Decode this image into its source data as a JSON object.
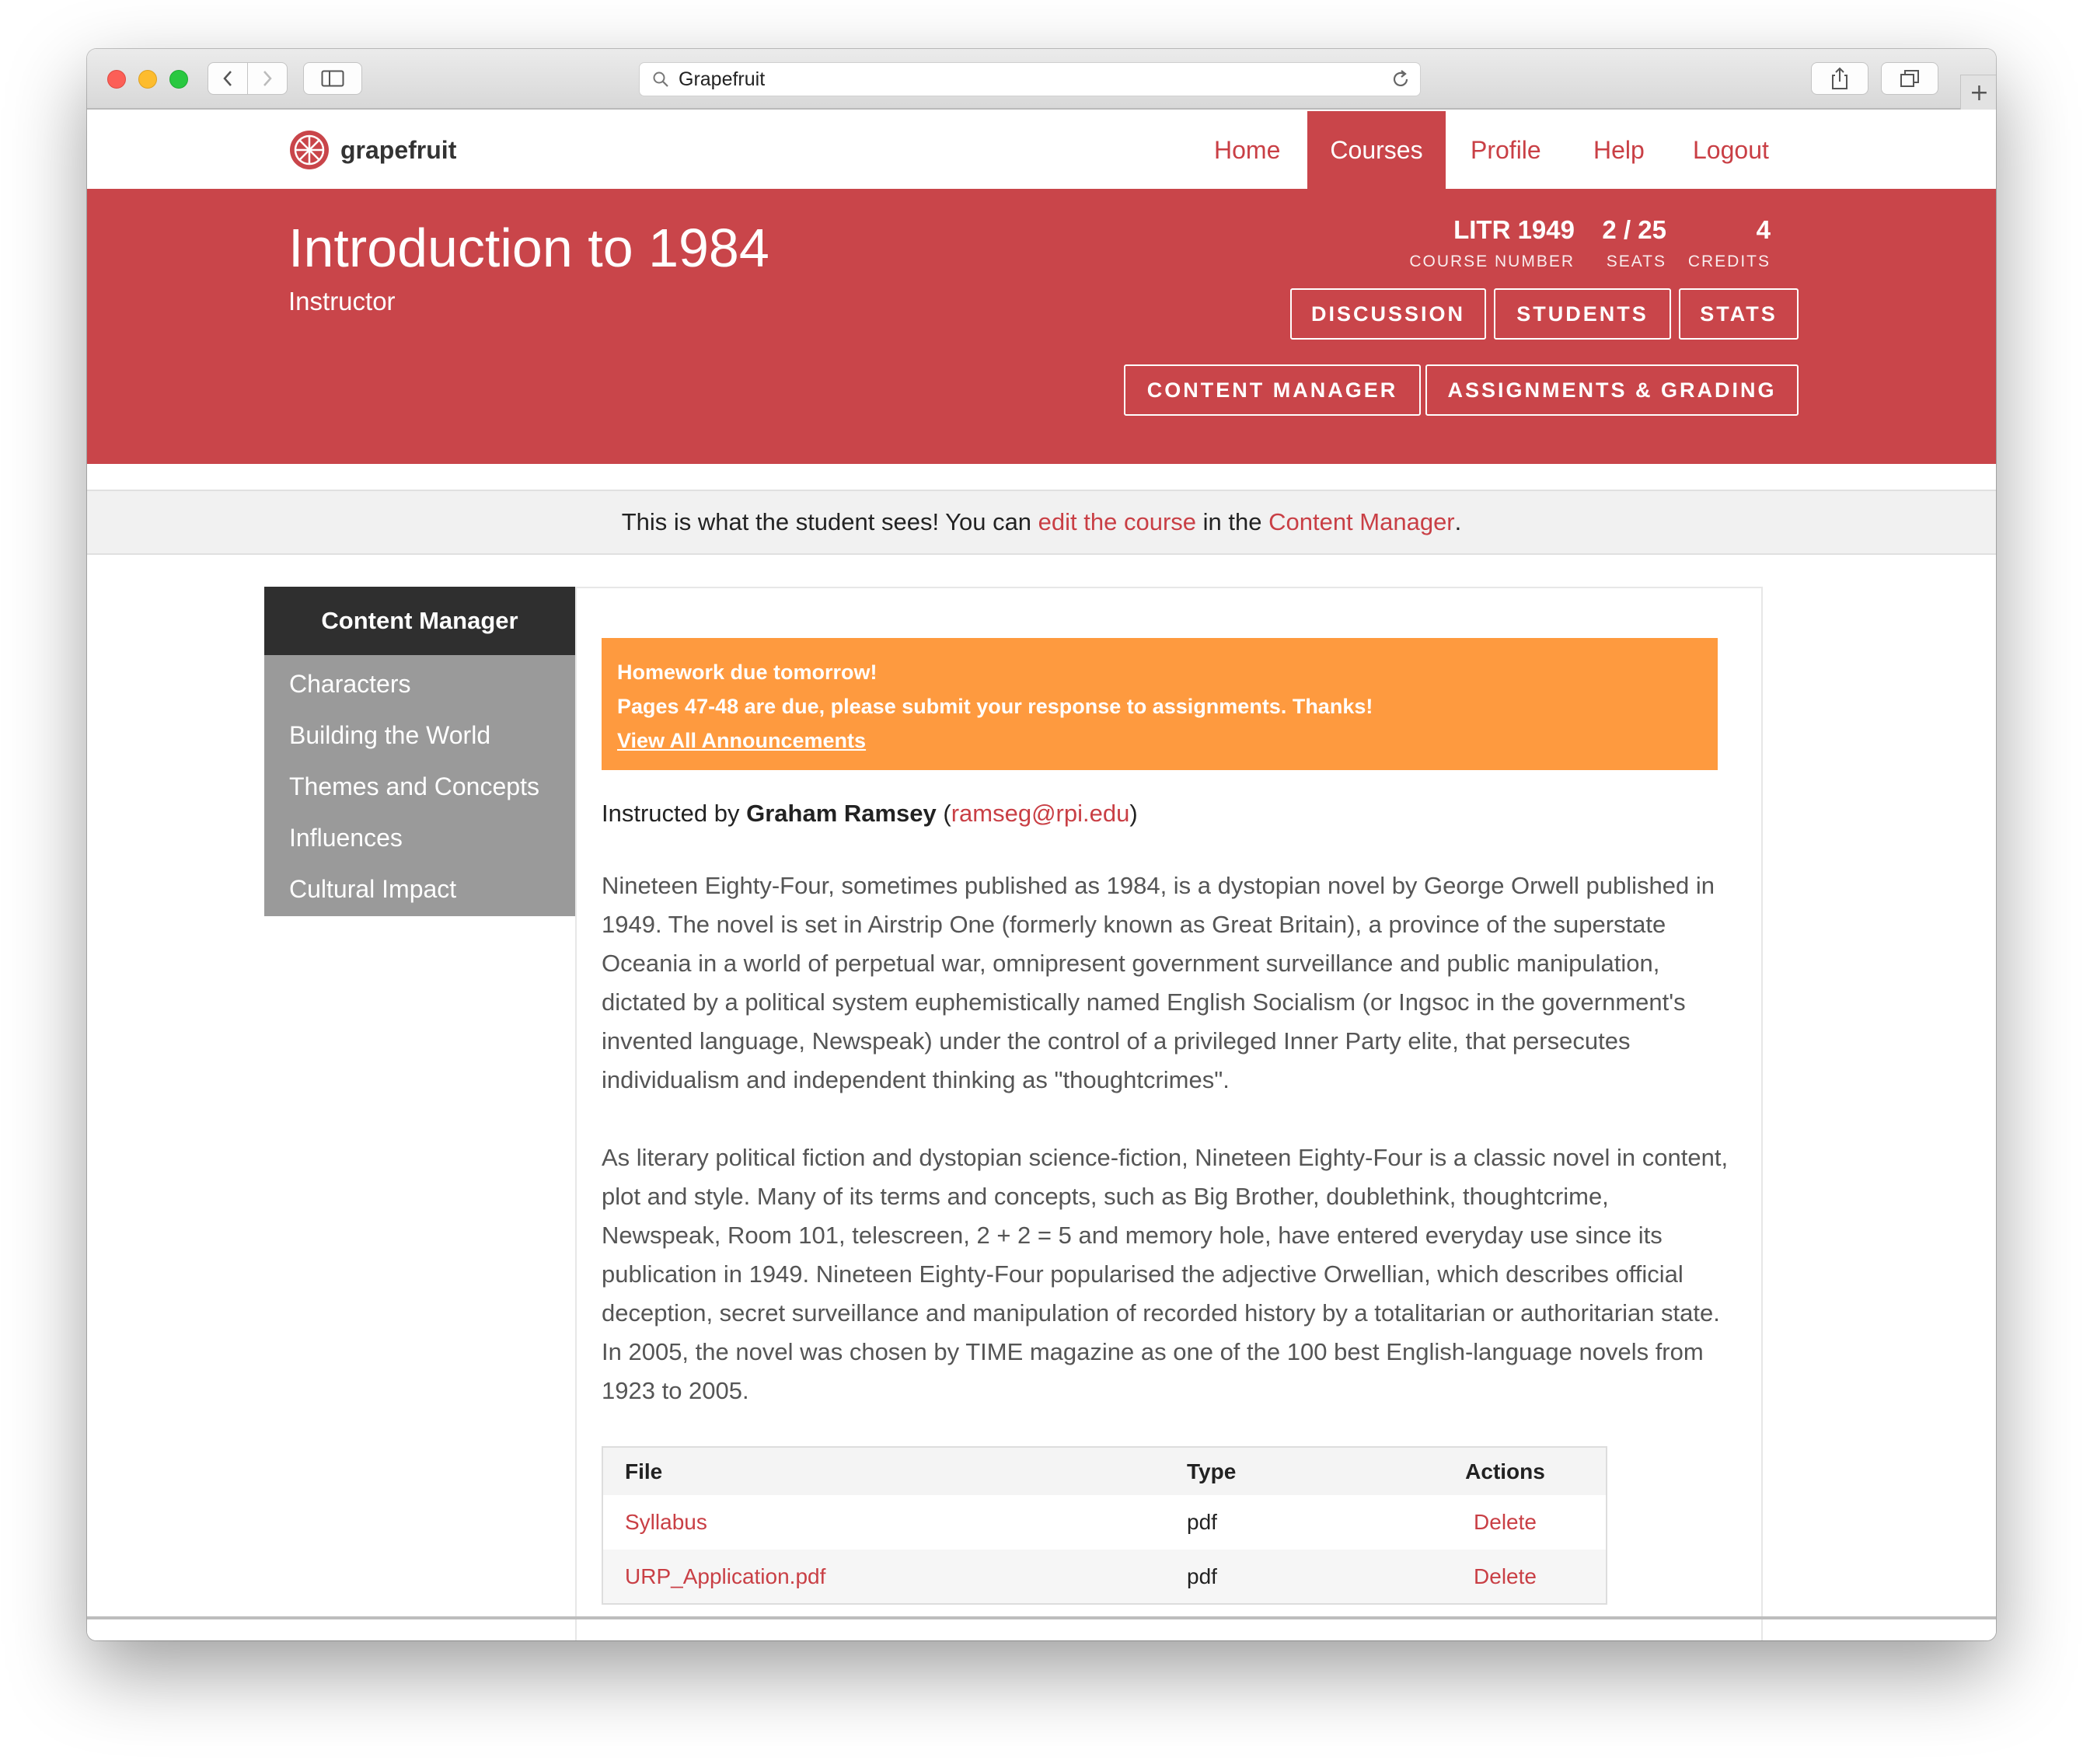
{
  "browser": {
    "url_text": "Grapefruit",
    "new_tab_label": "+"
  },
  "nav": {
    "brand": "grapefruit",
    "items": [
      {
        "label": "Home",
        "active": false
      },
      {
        "label": "Courses",
        "active": true
      },
      {
        "label": "Profile",
        "active": false
      },
      {
        "label": "Help",
        "active": false
      },
      {
        "label": "Logout",
        "active": false
      }
    ]
  },
  "course": {
    "title": "Introduction to 1984",
    "role": "Instructor",
    "stats": [
      {
        "value": "LITR 1949",
        "label": "COURSE NUMBER"
      },
      {
        "value": "2 / 25",
        "label": "SEATS"
      },
      {
        "value": "4",
        "label": "CREDITS"
      }
    ],
    "buttons_row1": [
      "DISCUSSION",
      "STUDENTS",
      "STATS"
    ],
    "buttons_row2": [
      "CONTENT MANAGER",
      "ASSIGNMENTS & GRADING"
    ]
  },
  "notice": {
    "prefix": "This is what the student sees! You can ",
    "link1": "edit the course",
    "middle": " in the ",
    "link2": "Content Manager",
    "suffix": "."
  },
  "sidebar": {
    "heading": "Content Manager",
    "items": [
      "Characters",
      "Building the World",
      "Themes and Concepts",
      "Influences",
      "Cultural Impact"
    ]
  },
  "announcement": {
    "title": "Homework due tomorrow!",
    "body": "Pages 47-48 are due, please submit your response to assignments. Thanks!",
    "link": "View All Announcements"
  },
  "instructor": {
    "prefix": "Instructed by ",
    "name": "Graham Ramsey",
    "email": "ramseg@rpi.edu",
    "open_paren": " (",
    "close_paren": ")"
  },
  "description": [
    "Nineteen Eighty-Four, sometimes published as 1984, is a dystopian novel by George Orwell published in 1949. The novel is set in Airstrip One (formerly known as Great Britain), a province of the superstate Oceania in a world of perpetual war, omnipresent government surveillance and public manipulation, dictated by a political system euphemistically named English Socialism (or Ingsoc in the government's invented language, Newspeak) under the control of a privileged Inner Party elite, that persecutes individualism and independent thinking as \"thoughtcrimes\".",
    "As literary political fiction and dystopian science-fiction, Nineteen Eighty-Four is a classic novel in content, plot and style. Many of its terms and concepts, such as Big Brother, doublethink, thoughtcrime, Newspeak, Room 101, telescreen, 2 + 2 = 5 and memory hole, have entered everyday use since its publication in 1949. Nineteen Eighty-Four popularised the adjective Orwellian, which describes official deception, secret surveillance and manipulation of recorded history by a totalitarian or authoritarian state. In 2005, the novel was chosen by TIME magazine as one of the 100 best English-language novels from 1923 to 2005."
  ],
  "files": {
    "headers": [
      "File",
      "Type",
      "Actions"
    ],
    "rows": [
      {
        "file": "Syllabus",
        "type": "pdf",
        "action": "Delete"
      },
      {
        "file": "URP_Application.pdf",
        "type": "pdf",
        "action": "Delete"
      }
    ]
  },
  "colors": {
    "brand_red": "#c9454a",
    "link_red": "#c93f45",
    "announcement_orange": "#fe9a3f",
    "sidebar_dark": "#2f2f2f",
    "sidebar_gray": "#9a9a9a"
  },
  "icons": [
    "back-chevron-icon",
    "forward-chevron-icon",
    "sidebar-icon",
    "search-icon",
    "reload-icon",
    "share-icon",
    "tabs-icon",
    "grapefruit-logo-icon"
  ]
}
